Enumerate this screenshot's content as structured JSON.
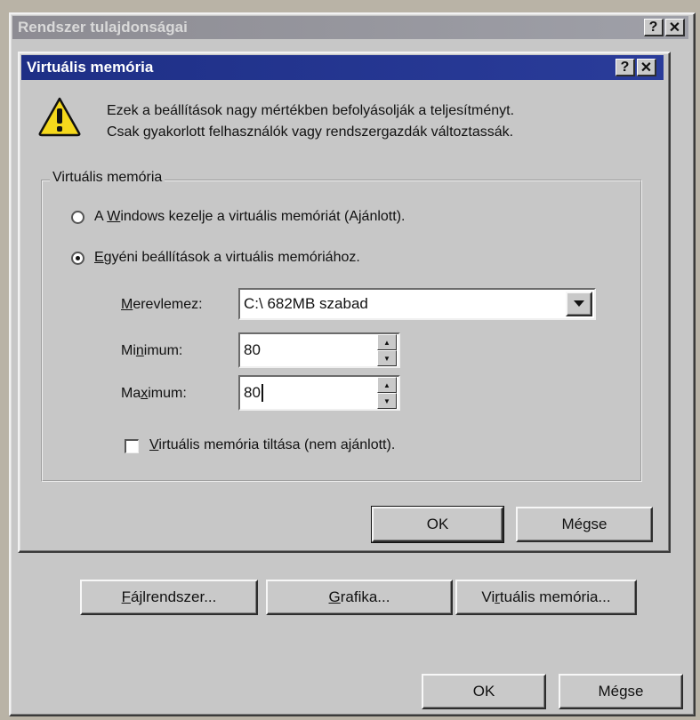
{
  "outer_window": {
    "title": "Rendszer tulajdonságai",
    "help_btn": "?",
    "close_btn": "✕",
    "buttons": {
      "filesystem_pre": "",
      "filesystem_ul": "F",
      "filesystem_post": "ájlrendszer...",
      "graphics_pre": "",
      "graphics_ul": "G",
      "graphics_post": "rafika...",
      "vmem_pre": "Vi",
      "vmem_ul": "r",
      "vmem_post": "tuális memória...",
      "ok": "OK",
      "cancel": "Mégse"
    }
  },
  "dialog": {
    "title": "Virtuális memória",
    "help_btn": "?",
    "close_btn": "✕",
    "warning_line1": "Ezek a beállítások nagy mértékben befolyásolják a teljesítményt.",
    "warning_line2": "Csak gyakorlott felhasználók vagy rendszergazdák változtassák.",
    "group_title": "Virtuális memória",
    "radio_windows_pre": "A ",
    "radio_windows_ul": "W",
    "radio_windows_post": "indows kezelje a virtuális memóriát (Ajánlott).",
    "radio_custom_pre": "",
    "radio_custom_ul": "E",
    "radio_custom_post": "gyéni beállítások a virtuális memóriához.",
    "selected_radio": "custom",
    "disk_label_ul": "M",
    "disk_label_post": "erevlemez:",
    "disk_value": "C:\\ 682MB szabad",
    "min_label_pre": "Mi",
    "min_label_ul": "n",
    "min_label_post": "imum:",
    "min_value": "80",
    "max_label_pre": "Ma",
    "max_label_ul": "x",
    "max_label_post": "imum:",
    "max_value": "80",
    "disable_pre": "",
    "disable_ul": "V",
    "disable_post": "irtuális memória tiltása (nem ajánlott).",
    "disable_checked": false,
    "ok": "OK",
    "cancel": "Mégse"
  },
  "icons": {
    "warning": "warning-icon",
    "dropdown": "chevron-down-icon"
  },
  "colors": {
    "active_title": "#1e2f86",
    "inactive_title": "#8d8c93",
    "face": "#c7c7c7"
  }
}
